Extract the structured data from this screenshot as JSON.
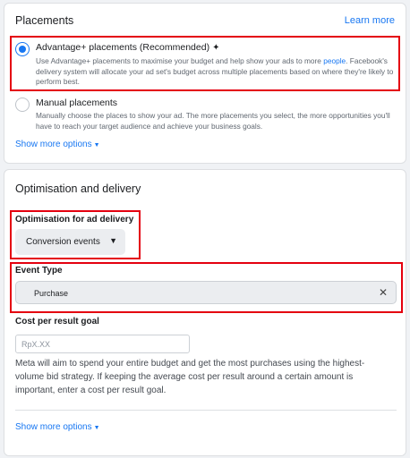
{
  "placements": {
    "title": "Placements",
    "learn_more": "Learn more",
    "advantage": {
      "label": "Advantage+ placements (Recommended)",
      "sparkle_icon": "sparkle-icon",
      "desc_part1": "Use Advantage+ placements to maximise your budget and help show your ads to more ",
      "desc_link": "people",
      "desc_part2": ". Facebook's delivery system will allocate your ad set's budget across multiple placements based on where they're likely to perform best.",
      "selected": true
    },
    "manual": {
      "label": "Manual placements",
      "desc": "Manually choose the places to show your ad. The more placements you select, the more opportunities you'll have to reach your target audience and achieve your business goals.",
      "selected": false
    },
    "show_more": "Show more options"
  },
  "optimisation": {
    "title": "Optimisation and delivery",
    "ad_delivery_label": "Optimisation for ad delivery",
    "ad_delivery_value": "Conversion events",
    "event_type_label": "Event Type",
    "event_type_value": "Purchase",
    "cost_label": "Cost per result goal",
    "cost_placeholder": "RpX.XX",
    "cost_help": "Meta will aim to spend your entire budget and get the most purchases using the highest-volume bid strategy. If keeping the average cost per result around a certain amount is important, enter a cost per result goal.",
    "show_more": "Show more options"
  },
  "colors": {
    "accent": "#1877f2",
    "highlight": "#e4000f",
    "page_bg": "#f0f2f5"
  }
}
